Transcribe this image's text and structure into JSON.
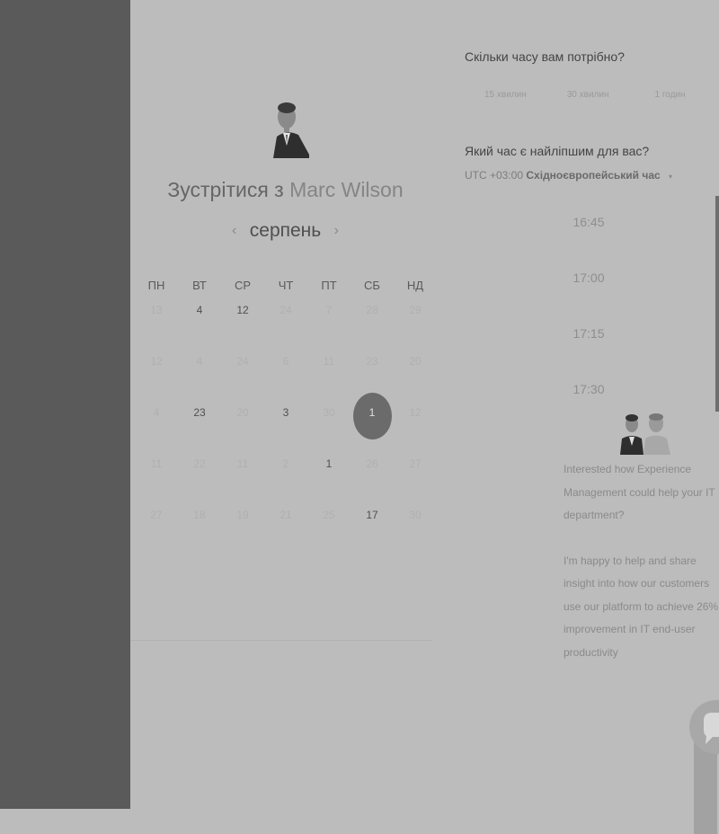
{
  "scheduler": {
    "title_prefix": "Зустрітися з",
    "host_name": "Marc Wilson",
    "month_label": "серпень"
  },
  "calendar": {
    "weekdays": [
      "ПН",
      "ВТ",
      "СР",
      "ЧТ",
      "ПТ",
      "СБ",
      "НД"
    ],
    "weeks": [
      [
        {
          "n": "13",
          "s": "dim"
        },
        {
          "n": "4",
          "s": "avail"
        },
        {
          "n": "12",
          "s": "avail"
        },
        {
          "n": "24",
          "s": "dim"
        },
        {
          "n": "7",
          "s": "dim"
        },
        {
          "n": "28",
          "s": "dim"
        },
        {
          "n": "29",
          "s": "dim"
        }
      ],
      [
        {
          "n": "12",
          "s": "dim"
        },
        {
          "n": "4",
          "s": "dim"
        },
        {
          "n": "24",
          "s": "dim"
        },
        {
          "n": "6",
          "s": "dim"
        },
        {
          "n": "11",
          "s": "dim"
        },
        {
          "n": "23",
          "s": "dim"
        },
        {
          "n": "20",
          "s": "dim"
        }
      ],
      [
        {
          "n": "4",
          "s": "dim"
        },
        {
          "n": "23",
          "s": "avail"
        },
        {
          "n": "20",
          "s": "dim"
        },
        {
          "n": "3",
          "s": "avail"
        },
        {
          "n": "30",
          "s": "dim"
        },
        {
          "n": "1",
          "s": "selected"
        },
        {
          "n": "12",
          "s": "dim"
        }
      ],
      [
        {
          "n": "11",
          "s": "dim"
        },
        {
          "n": "22",
          "s": "dim"
        },
        {
          "n": "11",
          "s": "dim"
        },
        {
          "n": "2",
          "s": "dim"
        },
        {
          "n": "1",
          "s": "avail"
        },
        {
          "n": "26",
          "s": "dim"
        },
        {
          "n": "27",
          "s": "dim"
        }
      ],
      [
        {
          "n": "27",
          "s": "dim"
        },
        {
          "n": "18",
          "s": "dim"
        },
        {
          "n": "19",
          "s": "dim"
        },
        {
          "n": "21",
          "s": "dim"
        },
        {
          "n": "25",
          "s": "dim"
        },
        {
          "n": "17",
          "s": "avail"
        },
        {
          "n": "30",
          "s": "dim"
        }
      ]
    ]
  },
  "duration": {
    "question": "Скільки часу вам потрібно?",
    "options": [
      "15 хвилин",
      "30 хвилин",
      "1 годин"
    ]
  },
  "timezone": {
    "question": "Який час є найліпшим для вас?",
    "offset": "UTC +03:00",
    "name": "Східноєвропейський час"
  },
  "time_slots": [
    "16:45",
    "17:00",
    "17:15",
    "17:30"
  ],
  "message": {
    "paragraph1": "Interested how Experience Management could help your IT department?",
    "paragraph2": "I'm happy to help and share insight into how our customers use our platform to achieve 26% improvement in IT end-user productivity"
  },
  "colors": {
    "selected_day": "#6b6b6b",
    "sidebar": "#5a5a5a",
    "panel": "#bcbcbc"
  },
  "icons": [
    "host-avatar",
    "chevron-left-icon",
    "chevron-right-icon",
    "dropdown-caret-icon",
    "team-avatars",
    "chat-bubble-icon"
  ]
}
